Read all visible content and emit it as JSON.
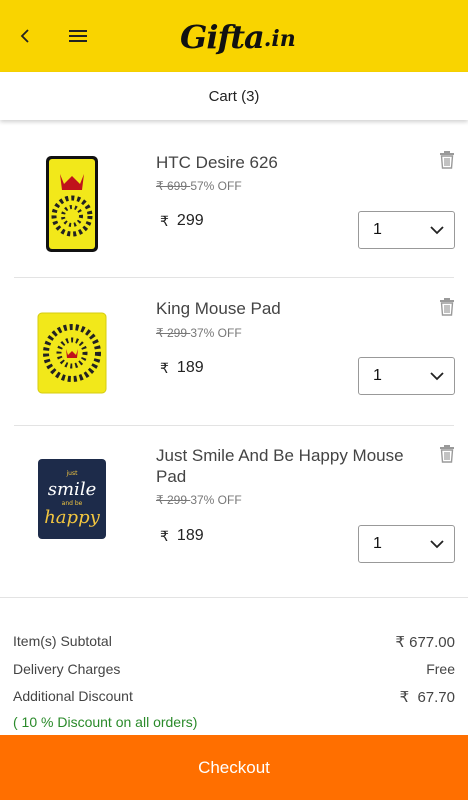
{
  "header": {
    "logo_main": "Gifta",
    "logo_tld": ".in",
    "back_icon": "chevron-left-icon",
    "menu_icon": "hamburger-menu-icon",
    "brand_color": "#f9d400"
  },
  "cart": {
    "title": "Cart (3)"
  },
  "items": [
    {
      "name": "HTC Desire 626",
      "old_price": "₹ 699 ",
      "discount": "57% OFF",
      "currency": "₹",
      "price": "299",
      "qty": "1"
    },
    {
      "name": "King Mouse Pad",
      "old_price": "₹ 299 ",
      "discount": "37% OFF",
      "currency": "₹",
      "price": "189",
      "qty": "1"
    },
    {
      "name": "Just Smile And Be Happy Mouse Pad",
      "old_price": "₹ 299 ",
      "discount": "37% OFF",
      "currency": "₹",
      "price": "189",
      "qty": "1",
      "artwork_text": [
        "just",
        "smile",
        "and be",
        "happy"
      ]
    }
  ],
  "summary": {
    "subtotal_label": "Item(s) Subtotal",
    "subtotal_value": "₹ 677.00",
    "delivery_label": "Delivery Charges",
    "delivery_value": "Free",
    "discount_label": "Additional Discount",
    "discount_value": "₹  67.70",
    "discount_note": "( 10 % Discount on all orders)"
  },
  "checkout": {
    "label": "Checkout",
    "color": "#ff6f00"
  }
}
